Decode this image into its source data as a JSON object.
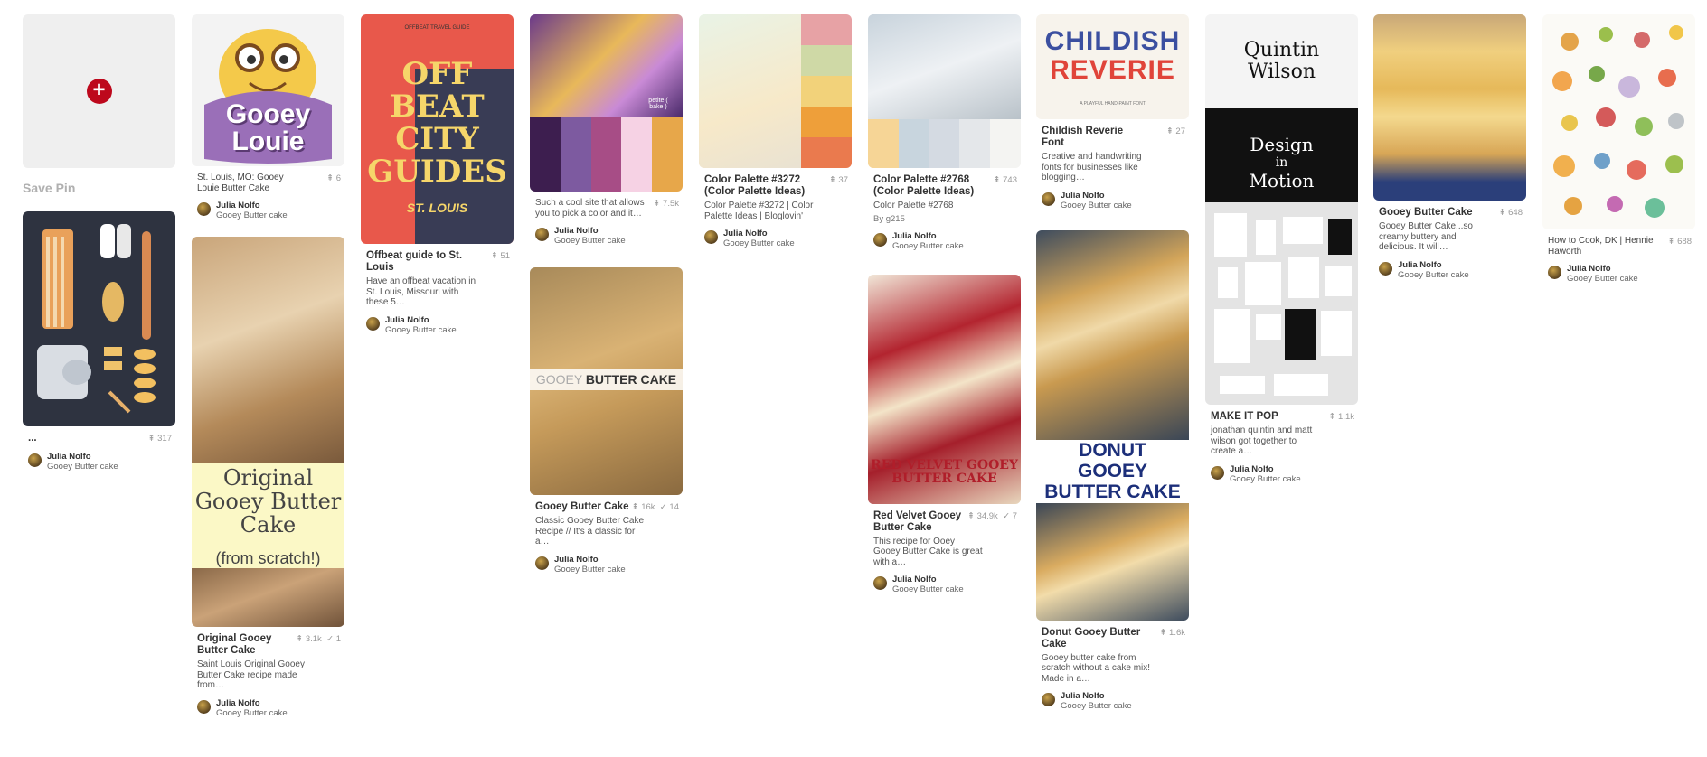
{
  "save": {
    "label": "Save Pin"
  },
  "pins": {
    "kitchen": {
      "title": "...",
      "saves": "317",
      "user": "Julia Nolfo",
      "board": "Gooey Butter cake"
    },
    "louie": {
      "img_line1": "Gooey",
      "img_line2": "Louie",
      "title": "St. Louis, MO: Gooey Louie Butter Cake",
      "saves": "6",
      "user": "Julia Nolfo",
      "board": "Gooey Butter cake"
    },
    "original": {
      "img_line1": "Original",
      "img_line2": "Gooey Butter",
      "img_line3": "Cake",
      "img_line4": "(from scratch!)",
      "title": "Original Gooey Butter Cake",
      "saves": "3.1k",
      "comments": "1",
      "desc": "Saint Louis Original Gooey Butter Cake recipe made from…",
      "user": "Julia Nolfo",
      "board": "Gooey Butter cake"
    },
    "offbeat": {
      "img_top": "OFFBEAT TRAVEL GUIDE",
      "img_line1": "OFF",
      "img_line2": "BEAT",
      "img_line3": "CITY",
      "img_line4": "GUIDES",
      "img_city": "ST. LOUIS",
      "title": "Offbeat guide to St. Louis",
      "saves": "51",
      "desc": "Have an offbeat vacation in St. Louis, Missouri with these 5…",
      "user": "Julia Nolfo",
      "board": "Gooey Butter cake"
    },
    "palette_purple": {
      "img_text": "petite ( bake )",
      "desc": "Such a cool site that allows you to pick a color and it…",
      "saves": "7.5k",
      "user": "Julia Nolfo",
      "board": "Gooey Butter cake"
    },
    "gooey_cake": {
      "img_text_light": "GOOEY",
      "img_text_bold": "BUTTER CAKE",
      "title": "Gooey Butter Cake",
      "saves": "16k",
      "comments": "14",
      "desc": "Classic Gooey Butter Cake Recipe // It's a classic for a…",
      "user": "Julia Nolfo",
      "board": "Gooey Butter cake"
    },
    "palette_3272": {
      "title": "Color Palette #3272 (Color Palette Ideas)",
      "saves": "37",
      "desc": "Color Palette #3272 | Color Palette Ideas | Bloglovin'",
      "user": "Julia Nolfo",
      "board": "Gooey Butter cake"
    },
    "palette_2768": {
      "title": "Color Palette #2768 (Color Palette Ideas)",
      "saves": "743",
      "desc": "Color Palette #2768",
      "by": "By g215",
      "user": "Julia Nolfo",
      "board": "Gooey Butter cake"
    },
    "red_velvet": {
      "img_line1": "RED VELVET GOOEY",
      "img_line2": "BUTTER CAKE",
      "title": "Red Velvet Gooey Butter Cake",
      "saves": "34.9k",
      "comments": "7",
      "desc": "This recipe for Ooey Gooey Butter Cake is great with a…",
      "user": "Julia Nolfo",
      "board": "Gooey Butter cake"
    },
    "childish": {
      "img_line1": "CHILDISH",
      "img_line2": "REVERIE",
      "img_sub": "A PLAYFUL HAND-PAINT FONT",
      "title": "Childish Reverie Font",
      "saves": "27",
      "desc": "Creative and handwriting fonts for businesses like blogging…",
      "user": "Julia Nolfo",
      "board": "Gooey Butter cake"
    },
    "donut": {
      "img_line1": "DONUT",
      "img_line2": "GOOEY",
      "img_line3": "BUTTER CAKE",
      "title": "Donut Gooey Butter Cake",
      "saves": "1.6k",
      "desc": "Gooey butter cake from scratch without a cake mix! Made in a…",
      "user": "Julia Nolfo",
      "board": "Gooey Butter cake"
    },
    "makeitpop": {
      "img_line1": "Quintin",
      "img_line2": "Wilson",
      "img_motion1": "Design",
      "img_motion2": "in",
      "img_motion3": "Motion",
      "title": "MAKE IT POP",
      "saves": "1.1k",
      "desc": "jonathan quintin and matt wilson got together to create a…",
      "user": "Julia Nolfo",
      "board": "Gooey Butter cake"
    },
    "stack": {
      "title": "Gooey Butter Cake",
      "saves": "648",
      "desc": "Gooey Butter Cake...so creamy buttery and delicious. It will…",
      "user": "Julia Nolfo",
      "board": "Gooey Butter cake"
    },
    "cook": {
      "title": "How to Cook, DK | Hennie Haworth",
      "saves": "688",
      "user": "Julia Nolfo",
      "board": "Gooey Butter cake"
    }
  }
}
